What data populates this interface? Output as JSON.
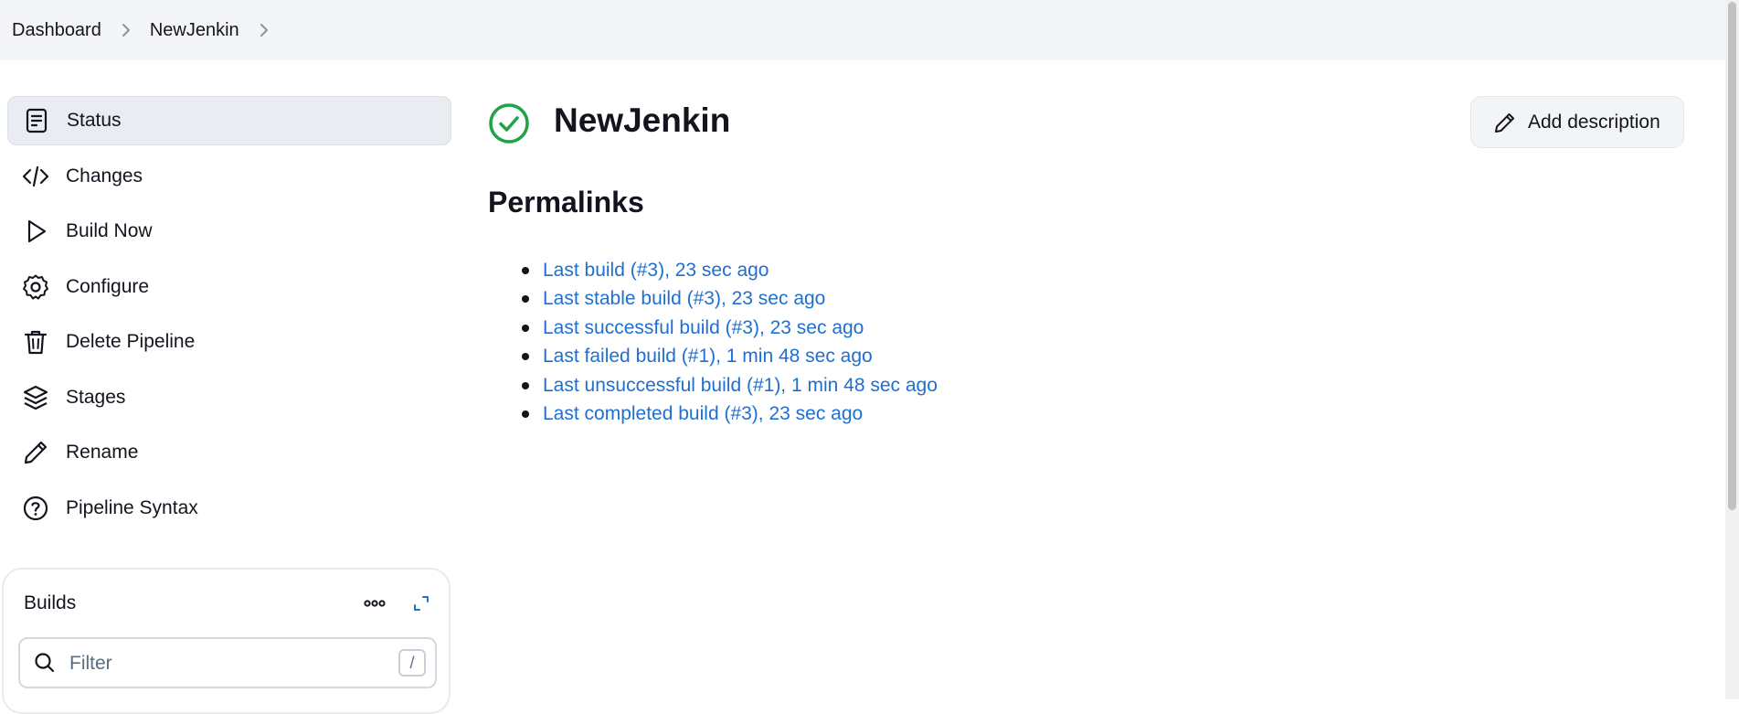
{
  "breadcrumb": {
    "items": [
      "Dashboard",
      "NewJenkin"
    ]
  },
  "sidebar": {
    "items": [
      {
        "label": "Status",
        "icon": "status-document-icon",
        "active": true
      },
      {
        "label": "Changes",
        "icon": "code-icon"
      },
      {
        "label": "Build Now",
        "icon": "play-icon"
      },
      {
        "label": "Configure",
        "icon": "gear-icon"
      },
      {
        "label": "Delete Pipeline",
        "icon": "trash-icon"
      },
      {
        "label": "Stages",
        "icon": "layers-icon"
      },
      {
        "label": "Rename",
        "icon": "pencil-icon"
      },
      {
        "label": "Pipeline Syntax",
        "icon": "help-circle-icon"
      }
    ]
  },
  "builds": {
    "title": "Builds",
    "filter_placeholder": "Filter",
    "filter_value": "",
    "shortcut": "/"
  },
  "main": {
    "title": "NewJenkin",
    "status": "success",
    "add_description_label": "Add description",
    "permalinks_title": "Permalinks",
    "permalinks": [
      "Last build (#3), 23 sec ago",
      "Last stable build (#3), 23 sec ago",
      "Last successful build (#3), 23 sec ago",
      "Last failed build (#1), 1 min 48 sec ago",
      "Last unsuccessful build (#1), 1 min 48 sec ago",
      "Last completed build (#3), 23 sec ago"
    ]
  },
  "colors": {
    "link": "#1f6fd1",
    "success": "#1ea446",
    "topbar": "#f4f5f7",
    "active_item": "#e9ecf1"
  }
}
